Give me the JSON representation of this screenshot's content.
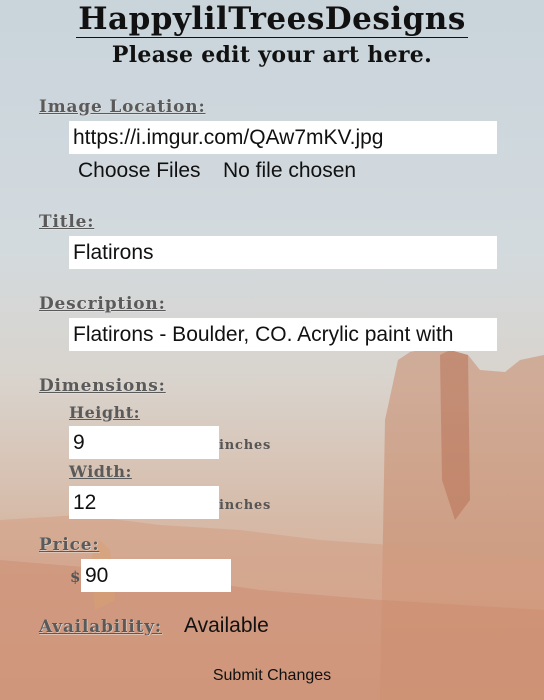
{
  "header": {
    "brand": "HappylilTreesDesigns",
    "subtitle": "Please edit your art here."
  },
  "form": {
    "image_location": {
      "label": "Image Location:",
      "value": "https://i.imgur.com/QAw7mKV.jpg",
      "file_button": "Choose Files",
      "file_status": "No file chosen"
    },
    "title": {
      "label": "Title:",
      "value": "Flatirons"
    },
    "description": {
      "label": "Description:",
      "value": "Flatirons - Boulder, CO. Acrylic paint with"
    },
    "dimensions": {
      "label": "Dimensions:",
      "height": {
        "label": "Height:",
        "value": "9",
        "unit": "inches"
      },
      "width": {
        "label": "Width:",
        "value": "12",
        "unit": "inches"
      }
    },
    "price": {
      "label": "Price:",
      "currency": "$",
      "value": "90"
    },
    "availability": {
      "label": "Availability:",
      "value": "Available"
    },
    "submit_label": "Submit Changes"
  },
  "colors": {
    "sky": "#cfd8de",
    "rock": "#c9805f",
    "label_text": "#5a5a5a"
  }
}
